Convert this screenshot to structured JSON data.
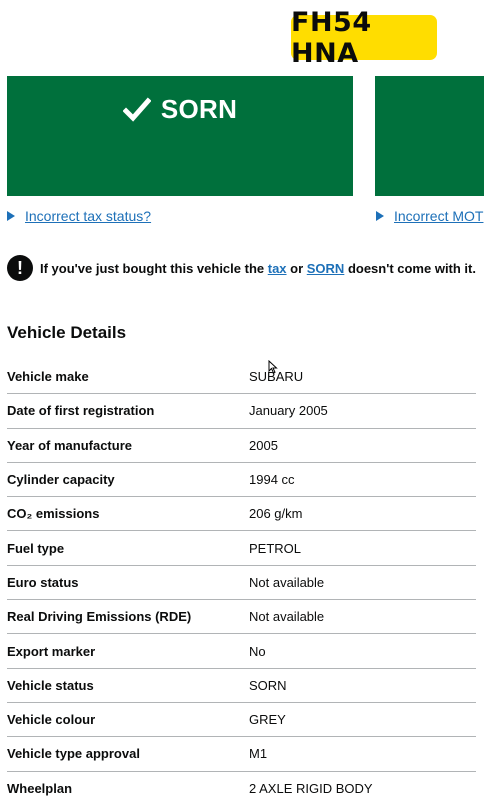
{
  "registration": "FH54 HNA",
  "tax_panel": {
    "status": "SORN",
    "icon": "check-icon"
  },
  "mot_panel": {
    "status": ""
  },
  "tax_link": {
    "label": "Incorrect tax status?"
  },
  "mot_link": {
    "label": "Incorrect MOT"
  },
  "warning": {
    "icon": "exclamation-icon",
    "text_before": "If you've just bought this vehicle the ",
    "link_tax": "tax",
    "text_or": " or ",
    "link_sorn": "SORN",
    "text_after": " doesn't come with it."
  },
  "vehicle_details": {
    "title": "Vehicle Details",
    "rows": [
      {
        "label": "Vehicle make",
        "value": "SUBARU"
      },
      {
        "label": "Date of first registration",
        "value": "January 2005"
      },
      {
        "label": "Year of manufacture",
        "value": "2005"
      },
      {
        "label": "Cylinder capacity",
        "value": "1994 cc"
      },
      {
        "label": "CO₂ emissions",
        "value": "206 g/km"
      },
      {
        "label": "Fuel type",
        "value": "PETROL"
      },
      {
        "label": "Euro status",
        "value": "Not available"
      },
      {
        "label": "Real Driving Emissions (RDE)",
        "value": "Not available"
      },
      {
        "label": "Export marker",
        "value": "No"
      },
      {
        "label": "Vehicle status",
        "value": "SORN"
      },
      {
        "label": "Vehicle colour",
        "value": "GREY"
      },
      {
        "label": "Vehicle type approval",
        "value": "M1"
      },
      {
        "label": "Wheelplan",
        "value": "2 AXLE RIGID BODY"
      }
    ]
  },
  "colors": {
    "plate": "#ffdd00",
    "panel_green": "#00703c",
    "link_blue": "#1d70b8",
    "text": "#0b0c0c",
    "divider": "#b1b4b6"
  }
}
